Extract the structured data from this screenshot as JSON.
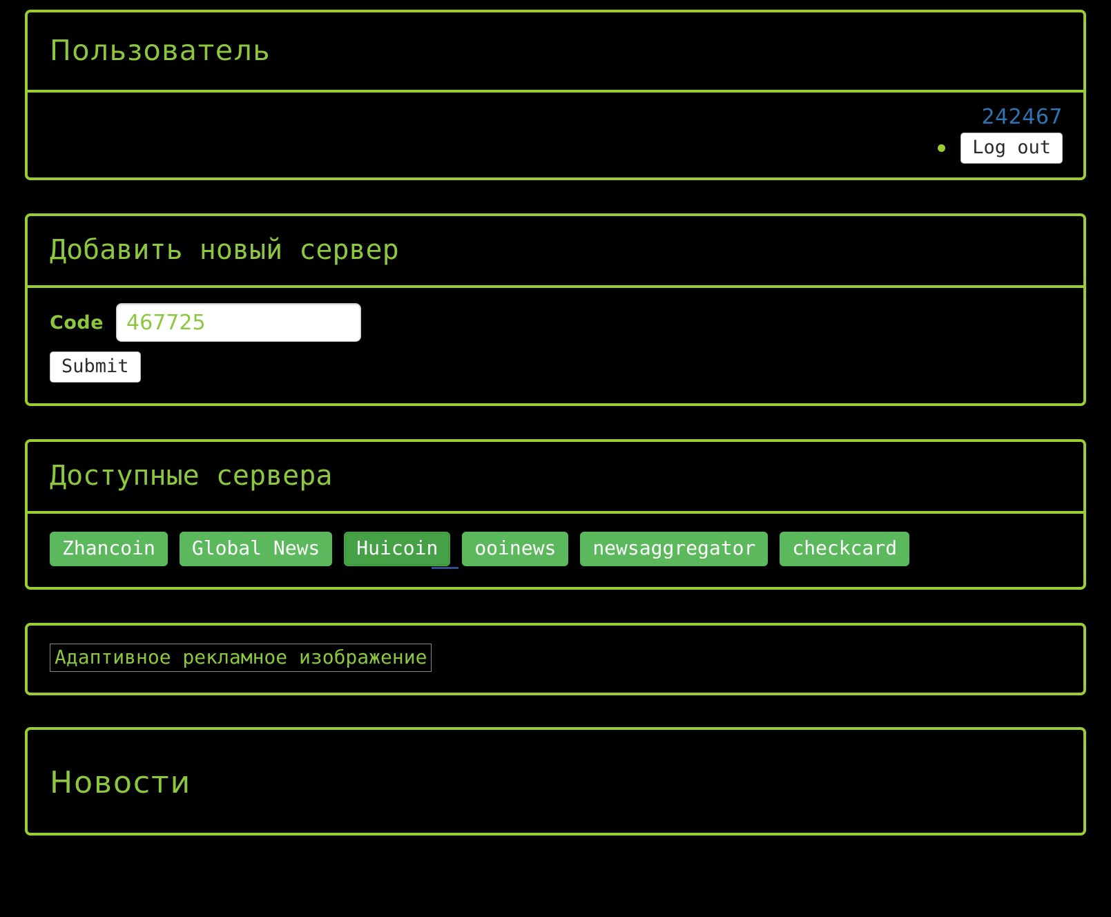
{
  "theme": {
    "background": "#000000",
    "accent_green": "#9acd32",
    "heading_green": "#8dc63f",
    "tag_green": "#5cb85c",
    "tag_green_active": "#46a046",
    "link_blue": "#2f73b3",
    "button_face": "#ffffff"
  },
  "user_panel": {
    "title": "Пользователь",
    "user_id": "242467",
    "actions": [
      {
        "label": "Log out",
        "icon": "bullet-icon"
      }
    ]
  },
  "add_server_panel": {
    "title": "Добавить новый сервер",
    "form": {
      "code_label": "Code",
      "code_value": "467725",
      "code_placeholder": "",
      "submit_label": "Submit"
    }
  },
  "available_servers_panel": {
    "title": "Доступные сервера",
    "servers": [
      {
        "label": "Zhancoin",
        "active": false
      },
      {
        "label": "Global News",
        "active": false
      },
      {
        "label": "Huicoin",
        "active": true
      },
      {
        "label": "ooinews",
        "active": false
      },
      {
        "label": "newsaggregator",
        "active": false
      },
      {
        "label": "checkcard",
        "active": false
      }
    ]
  },
  "advert_panel": {
    "image_alt": "Адаптивное рекламное изображение",
    "icon": "broken-image-icon"
  },
  "news_panel": {
    "title": "Новости"
  }
}
